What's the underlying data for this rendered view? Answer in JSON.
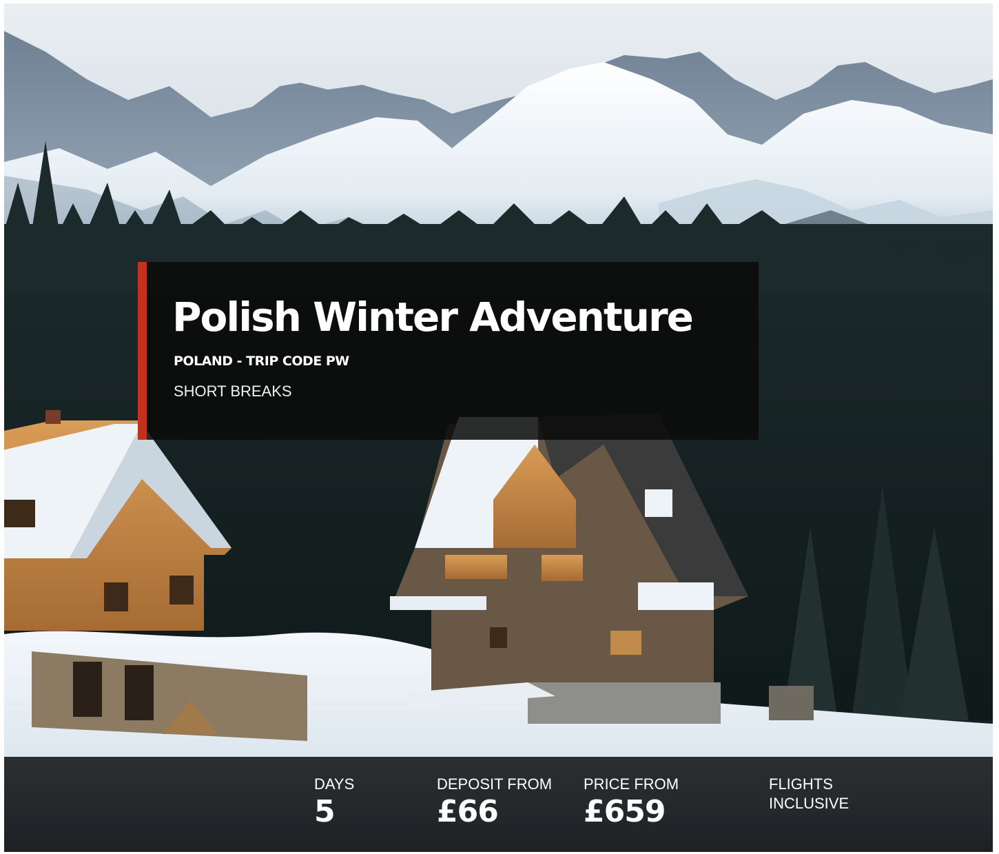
{
  "trip": {
    "title": "Polish Winter Adventure",
    "subtitle": "POLAND - TRIP CODE PW",
    "category": "SHORT BREAKS"
  },
  "stats": {
    "days": {
      "label": "DAYS",
      "value": "5"
    },
    "deposit": {
      "label": "DEPOSIT FROM",
      "value": "£66"
    },
    "price": {
      "label": "PRICE FROM",
      "value": "£659"
    },
    "flights": {
      "line1": "FLIGHTS",
      "line2": "INCLUSIVE"
    }
  },
  "colors": {
    "accent": "#c0321e",
    "panel": "#0a0a0a",
    "stats_bar": "#26292c",
    "text": "#ffffff"
  },
  "image": {
    "semantic": "snowy-mountain-chalets-photo"
  }
}
